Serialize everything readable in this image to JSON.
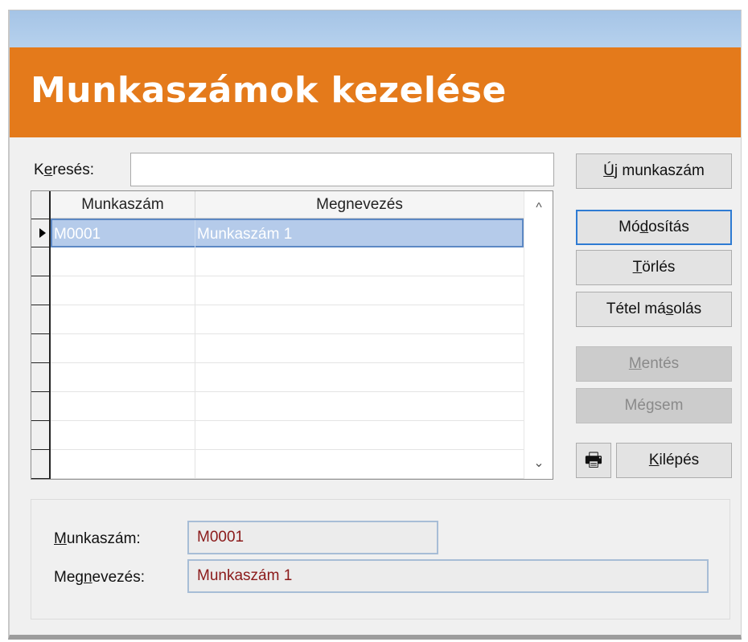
{
  "banner": {
    "title": "Munkaszámok kezelése"
  },
  "search": {
    "label_pre": "K",
    "label_key": "e",
    "label_post": "resés:",
    "value": ""
  },
  "grid": {
    "columns": [
      "Munkaszám",
      "Megnevezés"
    ],
    "rows": [
      {
        "code": "M0001",
        "name": "Munkaszám 1"
      }
    ],
    "scroll_up": "^",
    "scroll_down": "⌄"
  },
  "buttons": {
    "new": {
      "pre": "",
      "key": "Ú",
      "post": "j munkaszám"
    },
    "modify": {
      "pre": "Mó",
      "key": "d",
      "post": "osítás"
    },
    "delete": {
      "pre": "",
      "key": "T",
      "post": "örlés"
    },
    "copy": {
      "pre": "Tétel má",
      "key": "s",
      "post": "olás"
    },
    "save": {
      "pre": "",
      "key": "M",
      "post": "entés"
    },
    "cancel": {
      "pre": "Mé",
      "key": "g",
      "post": "sem"
    },
    "exit": {
      "pre": "",
      "key": "K",
      "post": "ilépés"
    },
    "print_icon": "🖶"
  },
  "detail": {
    "code_label": {
      "pre": "",
      "key": "M",
      "post": "unkaszám:"
    },
    "name_label": {
      "pre": "Meg",
      "key": "n",
      "post": "evezés:"
    },
    "code_value": "M0001",
    "name_value": "Munkaszám 1"
  },
  "colors": {
    "banner": "#e47a1b",
    "titlebar": "#a5c4e6",
    "selection": "#b5cbea",
    "field_text": "#8b1a1a"
  }
}
